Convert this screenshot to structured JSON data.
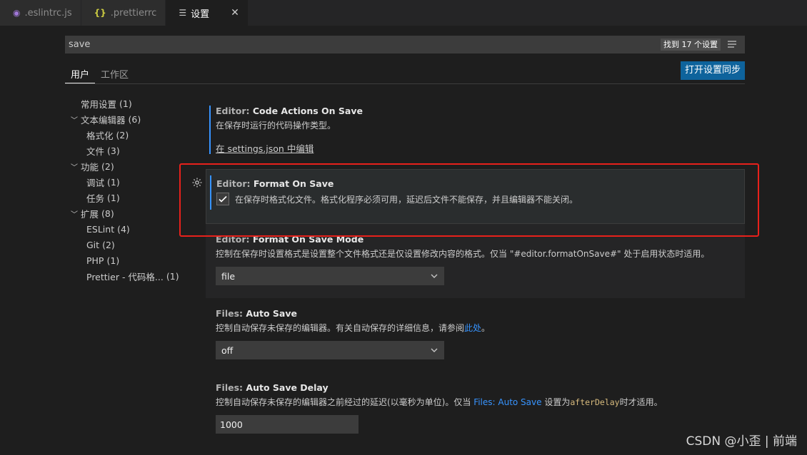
{
  "tabs": [
    {
      "icon": "eslint-icon",
      "label": ".eslintrc.js"
    },
    {
      "icon": "json-braces-icon",
      "label": ".prettierrc"
    },
    {
      "icon": "settings-file-icon",
      "label": "设置"
    }
  ],
  "search": {
    "value": "save",
    "result_count": "找到 17 个设置"
  },
  "scope": {
    "user": "用户",
    "workspace": "工作区",
    "sync_button": "打开设置同步"
  },
  "toc": [
    {
      "label": "常用设置",
      "count": "(1)",
      "level": 0,
      "chevron": false
    },
    {
      "label": "文本编辑器",
      "count": "(6)",
      "level": 0,
      "chevron": true
    },
    {
      "label": "格式化",
      "count": "(2)",
      "level": 1,
      "chevron": false
    },
    {
      "label": "文件",
      "count": "(3)",
      "level": 1,
      "chevron": false
    },
    {
      "label": "功能",
      "count": "(2)",
      "level": 0,
      "chevron": true
    },
    {
      "label": "调试",
      "count": "(1)",
      "level": 1,
      "chevron": false
    },
    {
      "label": "任务",
      "count": "(1)",
      "level": 1,
      "chevron": false
    },
    {
      "label": "扩展",
      "count": "(8)",
      "level": 0,
      "chevron": true
    },
    {
      "label": "ESLint",
      "count": "(4)",
      "level": 1,
      "chevron": false
    },
    {
      "label": "Git",
      "count": "(2)",
      "level": 1,
      "chevron": false
    },
    {
      "label": "PHP",
      "count": "(1)",
      "level": 1,
      "chevron": false
    },
    {
      "label": "Prettier - 代码格...",
      "count": "(1)",
      "level": 1,
      "chevron": false
    }
  ],
  "settings": {
    "code_actions": {
      "category": "Editor: ",
      "title": "Code Actions On Save",
      "desc": "在保存时运行的代码操作类型。",
      "edit_link": "在 settings.json 中编辑"
    },
    "format_on_save": {
      "category": "Editor: ",
      "title": "Format On Save",
      "desc": "在保存时格式化文件。格式化程序必须可用，延迟后文件不能保存，并且编辑器不能关闭。",
      "checked": true
    },
    "format_on_save_mode": {
      "category": "Editor: ",
      "title": "Format On Save Mode",
      "desc": "控制在保存时设置格式是设置整个文件格式还是仅设置修改内容的格式。仅当 \"#editor.formatOnSave#\" 处于启用状态时适用。",
      "value": "file"
    },
    "auto_save": {
      "category": "Files: ",
      "title": "Auto Save",
      "desc_before": "控制自动保存未保存的编辑器。有关自动保存的详细信息，请参阅",
      "desc_link": "此处",
      "desc_after": "。",
      "value": "off"
    },
    "auto_save_delay": {
      "category": "Files: ",
      "title": "Auto Save Delay",
      "desc_before": "控制自动保存未保存的编辑器之前经过的延迟(以毫秒为单位)。仅当 ",
      "desc_link": "Files: Auto Save",
      "desc_middle": " 设置为",
      "desc_code": "afterDelay",
      "desc_after": "时才适用。",
      "value": "1000"
    }
  },
  "watermark": "CSDN @小歪 | 前端"
}
